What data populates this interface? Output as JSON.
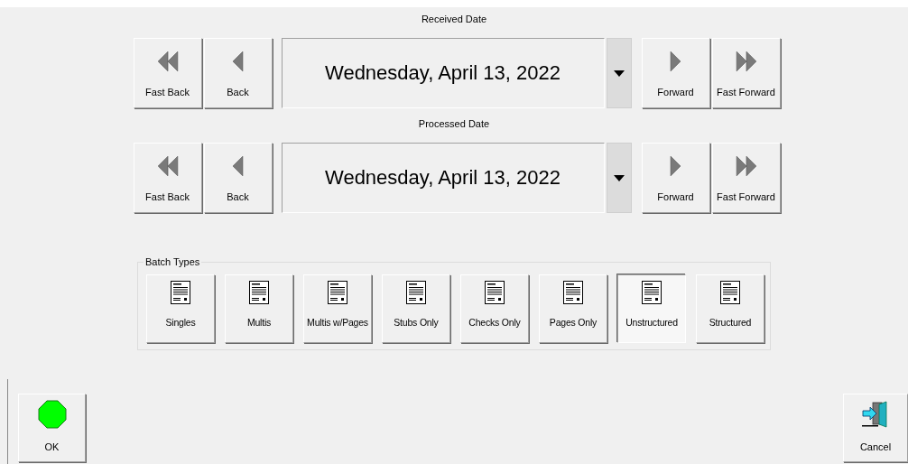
{
  "date_pickers": [
    {
      "label": "Received Date",
      "value": "Wednesday, April 13, 2022",
      "back_buttons": [
        {
          "label": "Fast Back",
          "kind": "fast-back"
        },
        {
          "label": "Back",
          "kind": "back"
        }
      ],
      "forward_buttons": [
        {
          "label": "Forward",
          "kind": "forward"
        },
        {
          "label": "Fast Forward",
          "kind": "fast-forward"
        }
      ]
    },
    {
      "label": "Processed Date",
      "value": "Wednesday, April 13, 2022",
      "back_buttons": [
        {
          "label": "Fast Back",
          "kind": "fast-back"
        },
        {
          "label": "Back",
          "kind": "back"
        }
      ],
      "forward_buttons": [
        {
          "label": "Forward",
          "kind": "forward"
        },
        {
          "label": "Fast Forward",
          "kind": "fast-forward"
        }
      ]
    }
  ],
  "batch_types": {
    "title": "Batch Types",
    "items": [
      {
        "label": "Singles",
        "selected": false
      },
      {
        "label": "Multis",
        "selected": false
      },
      {
        "label": "Multis w/Pages",
        "selected": false
      },
      {
        "label": "Stubs Only",
        "selected": false
      },
      {
        "label": "Checks Only",
        "selected": false
      },
      {
        "label": "Pages Only",
        "selected": false
      },
      {
        "label": "Unstructured",
        "selected": true
      },
      {
        "label": "Structured",
        "selected": false
      }
    ]
  },
  "buttons": [
    {
      "label": "OK",
      "kind": "ok"
    },
    {
      "label": "Cancel",
      "kind": "cancel"
    }
  ]
}
